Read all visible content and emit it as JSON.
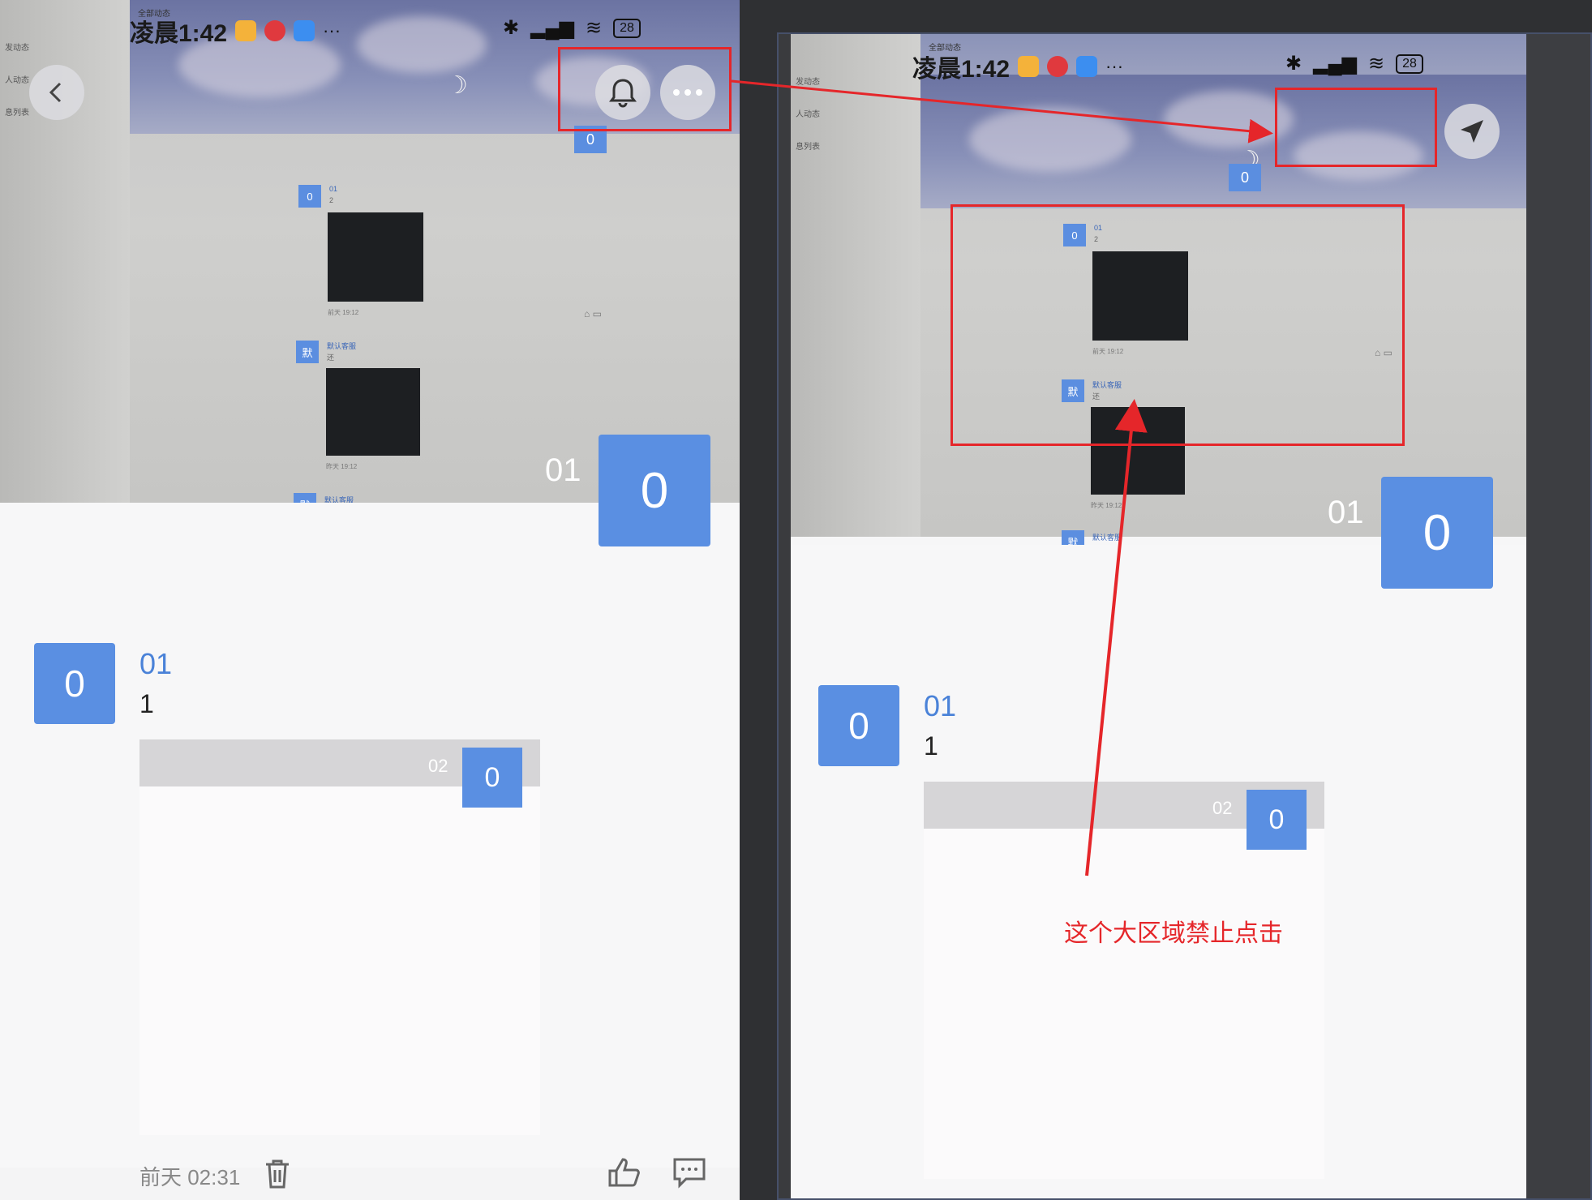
{
  "status_bar": {
    "time": "凌晨1:42",
    "battery": "28",
    "dots": "···",
    "signal_r": "R"
  },
  "monitor_labels": {
    "all_updates": "全部动态",
    "side": [
      "发动态",
      "人动态",
      "息列表"
    ]
  },
  "feed_preview": {
    "item1": {
      "avatar": "0",
      "name": "01",
      "text": "2",
      "meta": "前天 19:12"
    },
    "item2": {
      "avatar": "默",
      "name": "默认客服",
      "text": "还",
      "meta": "昨天 19:12"
    },
    "item3": {
      "avatar": "默",
      "name": "默认客服"
    },
    "top_badge": "0",
    "top_badge_label": "02"
  },
  "profile": {
    "badge": "0",
    "label": "01"
  },
  "post": {
    "avatar": "0",
    "name": "01",
    "text": "1",
    "card": {
      "bar_label": "02",
      "badge": "0"
    },
    "time": "前天 02:31"
  },
  "annotation": {
    "text": "这个大区域禁止点击"
  },
  "colors": {
    "accent": "#5a8fe2",
    "annotation": "#e5262a"
  }
}
